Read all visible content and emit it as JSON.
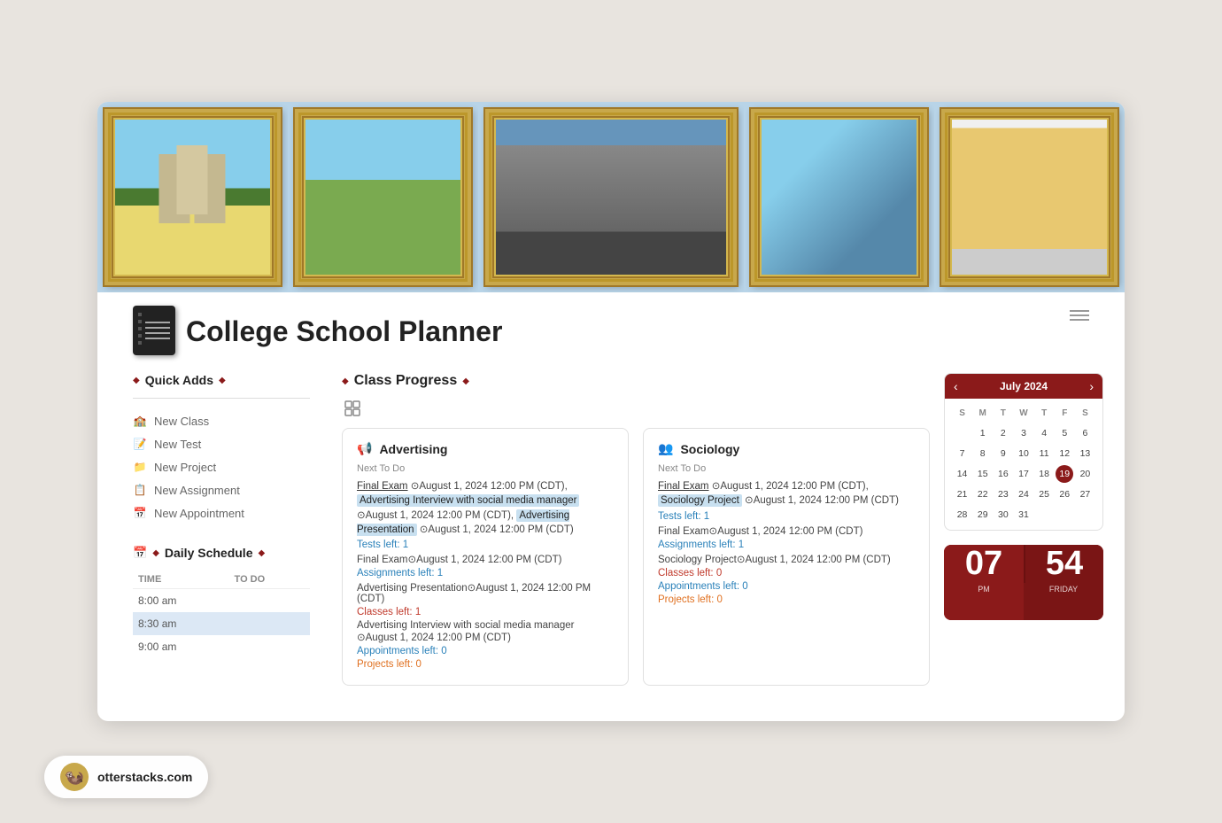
{
  "page": {
    "title": "College School Planner",
    "emoji": "📓"
  },
  "banner": {
    "frames": [
      {
        "id": "building",
        "type": "building"
      },
      {
        "id": "students",
        "type": "students"
      },
      {
        "id": "graduation",
        "type": "graduation"
      },
      {
        "id": "crowd",
        "type": "crowd"
      },
      {
        "id": "girl",
        "type": "girl"
      }
    ]
  },
  "sidebar": {
    "quick_adds_title": "Quick Adds",
    "items": [
      {
        "label": "New Class",
        "icon": "🏫"
      },
      {
        "label": "New Test",
        "icon": "📝"
      },
      {
        "label": "New Project",
        "icon": "📁"
      },
      {
        "label": "New Assignment",
        "icon": "📋"
      },
      {
        "label": "New Appointment",
        "icon": "📅"
      }
    ],
    "daily_schedule_title": "Daily Schedule",
    "schedule_headers": [
      "TIME",
      "TO DO"
    ],
    "schedule_rows": [
      {
        "time": "8:00 am",
        "todo": "",
        "highlight": false
      },
      {
        "time": "8:30 am",
        "todo": "",
        "highlight": true
      },
      {
        "time": "9:00 am",
        "todo": "",
        "highlight": false
      }
    ]
  },
  "class_progress": {
    "title": "Class Progress",
    "cards": [
      {
        "id": "advertising",
        "icon": "📢",
        "title": "Advertising",
        "next_to_do": "Next To Do",
        "tasks": [
          "Final Exam ⊙August 1, 2024 12:00 PM (CDT), Advertising Interview with social media manager ⊙August 1, 2024 12:00 PM (CDT), Advertising Presentation ⊙August 1, 2024 12:00 PM (CDT)"
        ],
        "tests_left": "Tests left: 1",
        "final_exam": "Final Exam⊙August 1, 2024 12:00 PM (CDT)",
        "assignments_left": "Assignments left: 1",
        "assignment_detail": "Advertising Presentation⊙August 1, 2024 12:00 PM (CDT)",
        "classes_left": "Classes left: 1",
        "class_detail": "Advertising Interview with social media manager ⊙August 1, 2024 12:00 PM (CDT)",
        "appointments_left": "Appointments left: 0",
        "projects_left": "Projects left: 0"
      },
      {
        "id": "sociology",
        "icon": "👥",
        "title": "Sociology",
        "next_to_do": "Next To Do",
        "tasks": [
          "Final Exam ⊙August 1, 2024 12:00 PM (CDT), Sociology Project ⊙August 1, 2024 12:00 PM (CDT)"
        ],
        "tests_left": "Tests left: 1",
        "final_exam": "Final Exam⊙August 1, 2024 12:00 PM (CDT)",
        "assignments_left": "Assignments left: 1",
        "assignment_detail": "Sociology Project⊙August 1, 2024 12:00 PM (CDT)",
        "classes_left": "Classes left: 0",
        "appointments_left": "Appointments left: 0",
        "projects_left": "Projects left: 0"
      }
    ]
  },
  "calendar": {
    "title": "July 2024",
    "days_header": [
      "S",
      "M",
      "T",
      "W",
      "T",
      "F",
      "S"
    ],
    "weeks": [
      [
        "",
        "",
        "",
        "1",
        "2",
        "3",
        "4",
        "5",
        "6"
      ],
      [
        "7",
        "8",
        "9",
        "10",
        "11",
        "12",
        "13"
      ],
      [
        "14",
        "15",
        "16",
        "17",
        "18",
        "19",
        "20"
      ],
      [
        "21",
        "22",
        "23",
        "24",
        "25",
        "26",
        "27"
      ],
      [
        "28",
        "29",
        "30",
        "31",
        "",
        "",
        ""
      ]
    ],
    "today": "19"
  },
  "clock": {
    "hours": "07",
    "minutes": "54",
    "period": "PM",
    "day": "FRIDAY"
  },
  "watermark": {
    "site": "otterstacks.com",
    "emoji": "🦦"
  }
}
